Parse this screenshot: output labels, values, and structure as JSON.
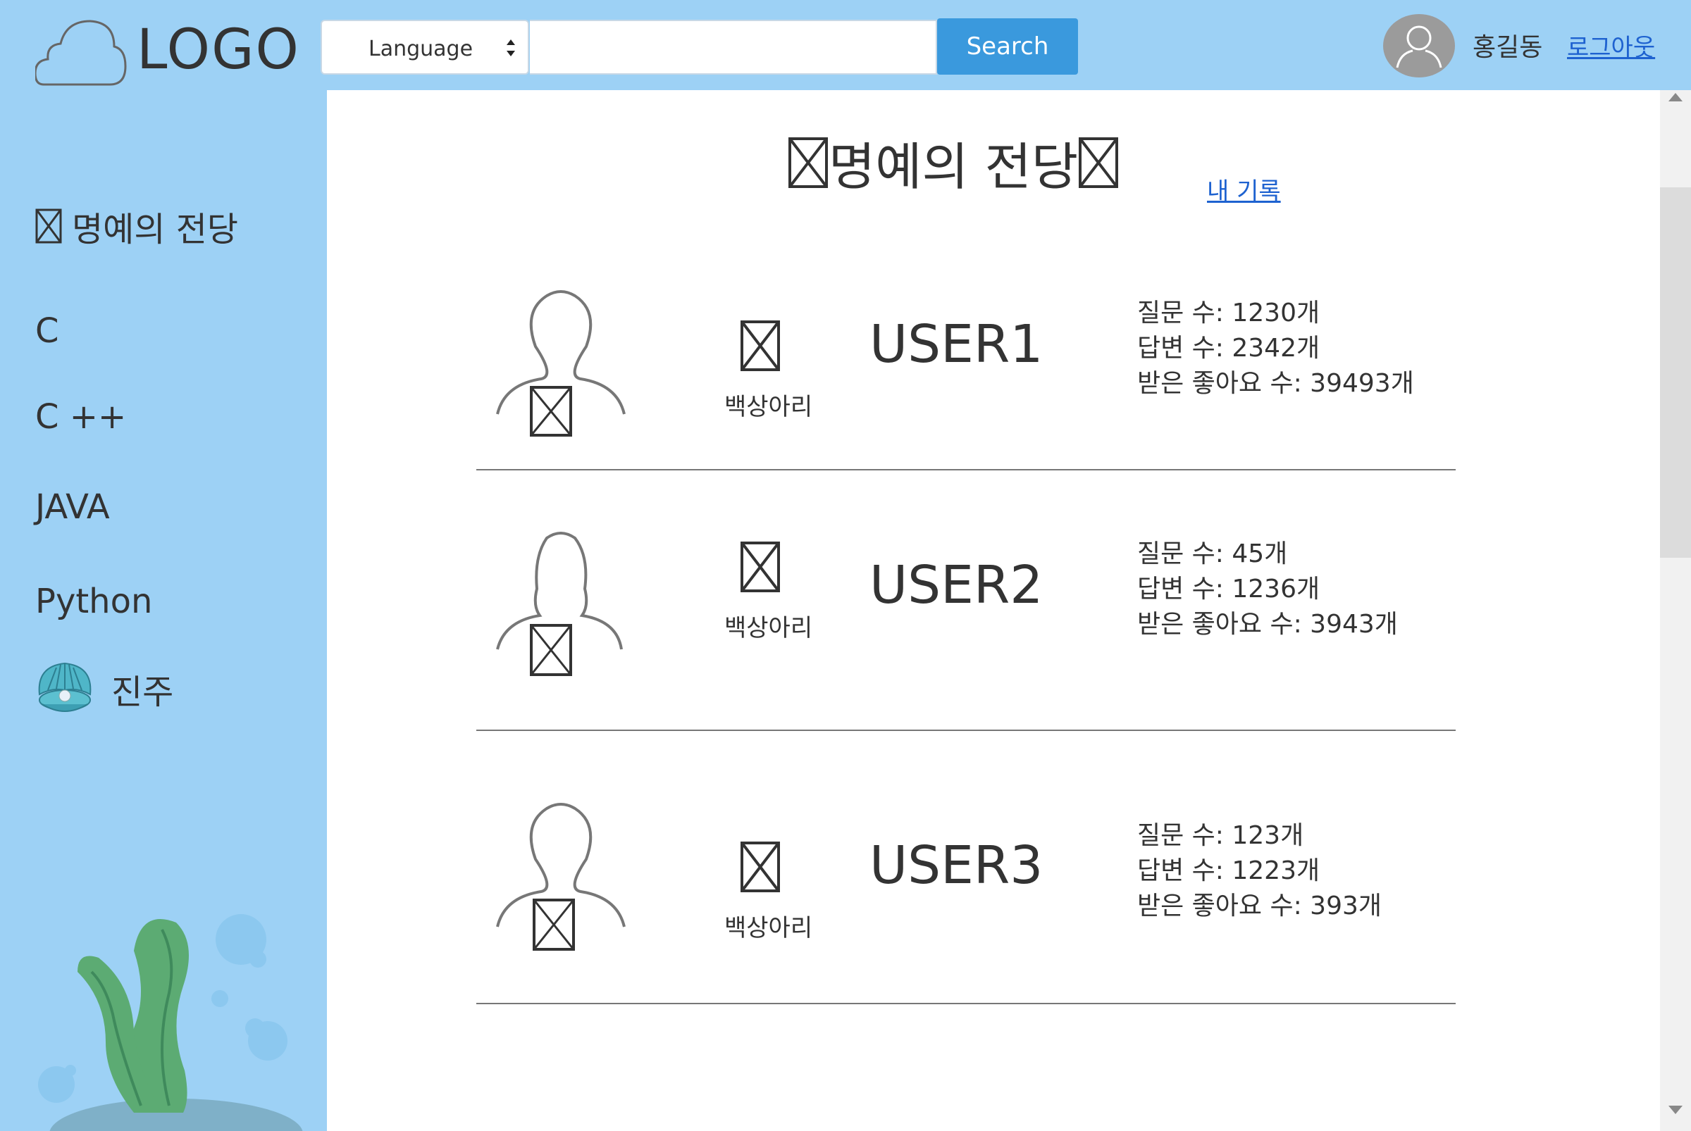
{
  "header": {
    "logo_text": "LOGO",
    "language_label": "Language",
    "search_value": "",
    "search_button": "Search",
    "user_name": "홍길동",
    "logout_label": "로그아웃"
  },
  "sidebar": {
    "items": [
      {
        "label": "명예의 전당",
        "icon": "missing-glyph-box"
      },
      {
        "label": "C"
      },
      {
        "label": "C ++"
      },
      {
        "label": "JAVA"
      },
      {
        "label": "Python"
      },
      {
        "label": "진주",
        "icon": "pearl-shell-icon"
      }
    ]
  },
  "main": {
    "title": "명예의 전당",
    "my_record_link": "내 기록",
    "users": [
      {
        "name": "USER1",
        "club": "백상아리",
        "questions": "질문 수: 1230개",
        "answers": "답변 수: 2342개",
        "likes": "받은 좋아요 수: 39493개"
      },
      {
        "name": "USER2",
        "club": "백상아리",
        "questions": "질문 수: 45개",
        "answers": "답변 수: 1236개",
        "likes": "받은 좋아요 수: 3943개"
      },
      {
        "name": "USER3",
        "club": "백상아리",
        "questions": "질문 수: 123개",
        "answers": "답변 수: 1223개",
        "likes": "받은 좋아요 수: 393개"
      }
    ]
  },
  "colors": {
    "background": "#9dd1f5",
    "search_button": "#3a99dd",
    "link": "#1e62d0",
    "panel": "#ffffff"
  }
}
